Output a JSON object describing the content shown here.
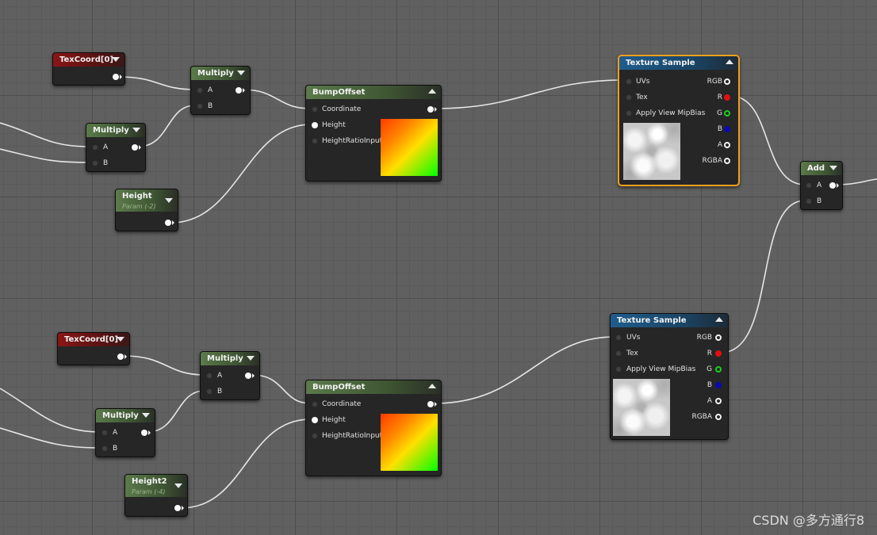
{
  "nodes": {
    "texcoord_top": {
      "title": "TexCoord[0]"
    },
    "multiply_top_outer": {
      "title": "Multiply",
      "pin_a": "A",
      "pin_b": "B"
    },
    "multiply_top_inner": {
      "title": "Multiply",
      "pin_a": "A",
      "pin_b": "B"
    },
    "height_top": {
      "title": "Height",
      "subtitle": "Param (-2)"
    },
    "bumpoffset_top": {
      "title": "BumpOffset",
      "pins": [
        "Coordinate",
        "Height",
        "HeightRatioInput"
      ]
    },
    "texture_sample_top": {
      "title": "Texture Sample",
      "inputs": [
        "UVs",
        "Tex",
        "Apply View MipBias"
      ],
      "outputs": [
        "RGB",
        "R",
        "G",
        "B",
        "A",
        "RGBA"
      ]
    },
    "add": {
      "title": "Add",
      "pin_a": "A",
      "pin_b": "B"
    },
    "texcoord_bottom": {
      "title": "TexCoord[0]"
    },
    "multiply_bottom_outer": {
      "title": "Multiply",
      "pin_a": "A",
      "pin_b": "B"
    },
    "multiply_bottom_inner": {
      "title": "Multiply",
      "pin_a": "A",
      "pin_b": "B"
    },
    "height_bottom": {
      "title": "Height2",
      "subtitle": "Param (-4)"
    },
    "bumpoffset_bottom": {
      "title": "BumpOffset",
      "pins": [
        "Coordinate",
        "Height",
        "HeightRatioInput"
      ]
    },
    "texture_sample_bottom": {
      "title": "Texture Sample",
      "inputs": [
        "UVs",
        "Tex",
        "Apply View MipBias"
      ],
      "outputs": [
        "RGB",
        "R",
        "G",
        "B",
        "A",
        "RGBA"
      ]
    }
  },
  "colors": {
    "wire": "#e6e6e6",
    "selected_outline": "#f0a020",
    "header_red": "#8a1616",
    "header_green": "#5b7a4b",
    "header_blue": "#1f5d8d"
  },
  "watermark": "CSDN @多方通行8"
}
